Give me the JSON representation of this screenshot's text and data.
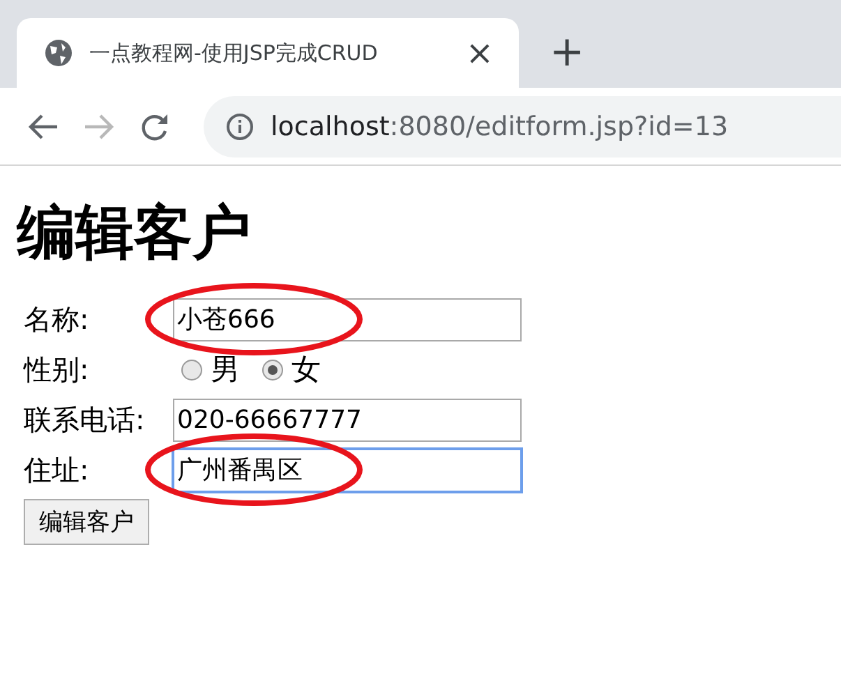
{
  "browser": {
    "tab_title": "一点教程网-使用JSP完成CRUD",
    "close": "×",
    "new_tab": "+",
    "url_host": "localhost",
    "url_rest": ":8080/editform.jsp?id=13"
  },
  "heading": "编辑客户",
  "fields": [
    {
      "kind": "text",
      "label": "名称:",
      "value": "小苍666",
      "focused": false,
      "circled": true
    },
    {
      "kind": "radio",
      "label": "性别:",
      "options": [
        {
          "label": "男",
          "selected": false
        },
        {
          "label": "女",
          "selected": true
        }
      ]
    },
    {
      "kind": "text",
      "label": "联系电话:",
      "value": "020-66667777",
      "focused": false,
      "circled": false
    },
    {
      "kind": "text",
      "label": "住址:",
      "value": "广州番禺区",
      "focused": true,
      "circled": true
    }
  ],
  "submit": "编辑客户"
}
